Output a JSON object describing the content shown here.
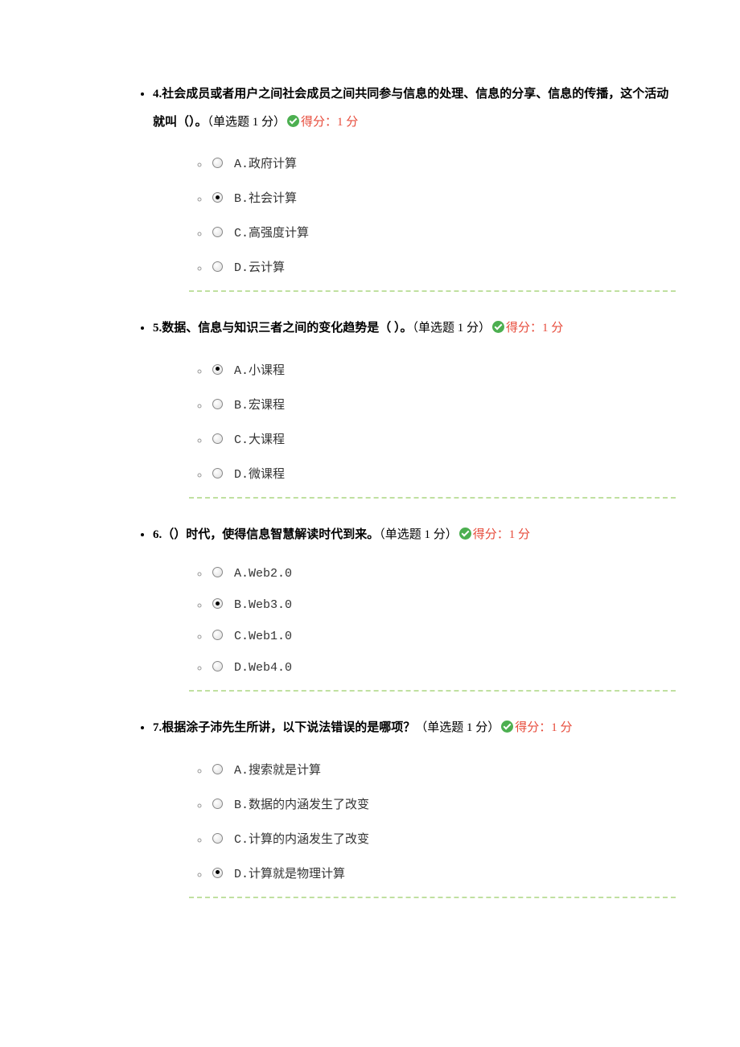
{
  "score_label": "得分：1 分",
  "question_type_label": "（单选题 1 分）",
  "questions": [
    {
      "number": "4.",
      "text": "社会成员或者用户之间社会成员之间共同参与信息的处理、信息的分享、信息的传播，这个活动就叫（）。",
      "selected": 1,
      "options": [
        {
          "letter": "A.",
          "text": "政府计算"
        },
        {
          "letter": "B.",
          "text": "社会计算"
        },
        {
          "letter": "C.",
          "text": "高强度计算"
        },
        {
          "letter": "D.",
          "text": "云计算"
        }
      ]
    },
    {
      "number": "5.",
      "text": "数据、信息与知识三者之间的变化趋势是（ ）。",
      "selected": 0,
      "options": [
        {
          "letter": "A.",
          "text": "小课程"
        },
        {
          "letter": "B.",
          "text": "宏课程"
        },
        {
          "letter": "C.",
          "text": "大课程"
        },
        {
          "letter": "D.",
          "text": "微课程"
        }
      ]
    },
    {
      "number": "6.",
      "text": "（）时代，使得信息智慧解读时代到来。",
      "selected": 1,
      "options": [
        {
          "letter": "A.",
          "text": "Web2.0"
        },
        {
          "letter": "B.",
          "text": "Web3.0"
        },
        {
          "letter": "C.",
          "text": "Web1.0"
        },
        {
          "letter": "D.",
          "text": "Web4.0"
        }
      ]
    },
    {
      "number": "7.",
      "text": "根据涂子沛先生所讲，以下说法错误的是哪项？",
      "selected": 3,
      "options": [
        {
          "letter": "A.",
          "text": "搜索就是计算"
        },
        {
          "letter": "B.",
          "text": "数据的内涵发生了改变"
        },
        {
          "letter": "C.",
          "text": "计算的内涵发生了改变"
        },
        {
          "letter": "D.",
          "text": "计算就是物理计算"
        }
      ]
    }
  ]
}
